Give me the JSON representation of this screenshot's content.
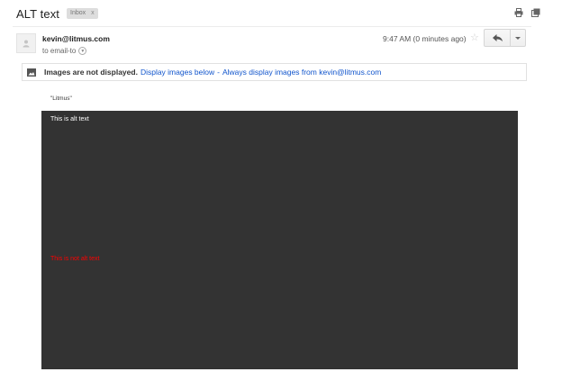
{
  "message": {
    "subject": "ALT text",
    "label": "Inbox",
    "label_close": "x",
    "sender": "kevin@litmus.com",
    "recipient_line": "to email-to",
    "time": "9:47 AM (0 minutes ago)"
  },
  "images_bar": {
    "warning": "Images are not displayed.",
    "display_below": "Display images below",
    "separator": "-",
    "always_display": "Always display images from kevin@litmus.com"
  },
  "body": {
    "quote": "\"Litmus\"",
    "alt_text": "This is alt text",
    "not_alt_text": "This is not alt text"
  },
  "colors": {
    "image_background": "#333333",
    "link": "#1155cc",
    "not_alt_text": "#ff0000"
  },
  "icons": [
    "print-icon",
    "new-window-icon",
    "avatar-icon",
    "star-icon",
    "reply-icon",
    "dropdown-caret-icon",
    "image-icon"
  ]
}
